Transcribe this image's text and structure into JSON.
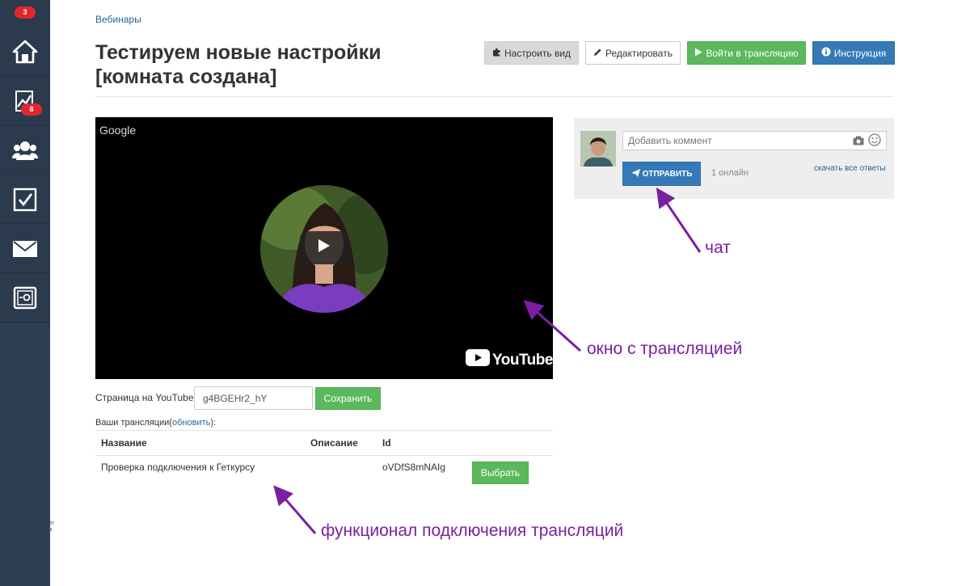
{
  "sidebar": {
    "top_badge": "3",
    "items": [
      {
        "icon": "home-icon"
      },
      {
        "icon": "chart-icon",
        "badge": "8"
      },
      {
        "icon": "users-icon"
      },
      {
        "icon": "checkbox-icon"
      },
      {
        "icon": "mail-icon"
      },
      {
        "icon": "safe-icon"
      }
    ],
    "color": "#2b3b4d"
  },
  "breadcrumb": "Вебинары",
  "page_title": "Тестируем новые настройки [комната создана]",
  "toolbar": {
    "customize_label": "Настроить вид",
    "edit_label": "Редактировать",
    "enter_label": "Войти в трансляцию",
    "instruction_label": "Инструкция"
  },
  "video": {
    "watermark": "Google",
    "brand": "YouTube"
  },
  "youtube_page": {
    "label": "Страница на YouTube:",
    "value": "g4BGEHr2_hY",
    "save_label": "Сохранить"
  },
  "streams": {
    "caption_prefix": "Ваши трансляции(",
    "refresh_link": "обновить",
    "caption_suffix": "):",
    "columns": [
      "Название",
      "Описание",
      "Id"
    ],
    "rows": [
      {
        "name": "Проверка подключения к Геткурсу",
        "description": "",
        "id": "oVDfS8mNAIg",
        "action": "Выбрать"
      }
    ]
  },
  "chat": {
    "placeholder": "Добавить коммент",
    "send_label": "ОТПРАВИТЬ",
    "online": "1 онлайн",
    "download_link": "скачать все ответы"
  },
  "annotations": {
    "chat": "чат",
    "stream_window": "окно с трансляцией",
    "connection": "функционал подключения трансляций"
  },
  "colors": {
    "green": "#5cb85c",
    "blue": "#337ab7",
    "annotation": "#7b1fa2",
    "link": "#2a6496"
  }
}
